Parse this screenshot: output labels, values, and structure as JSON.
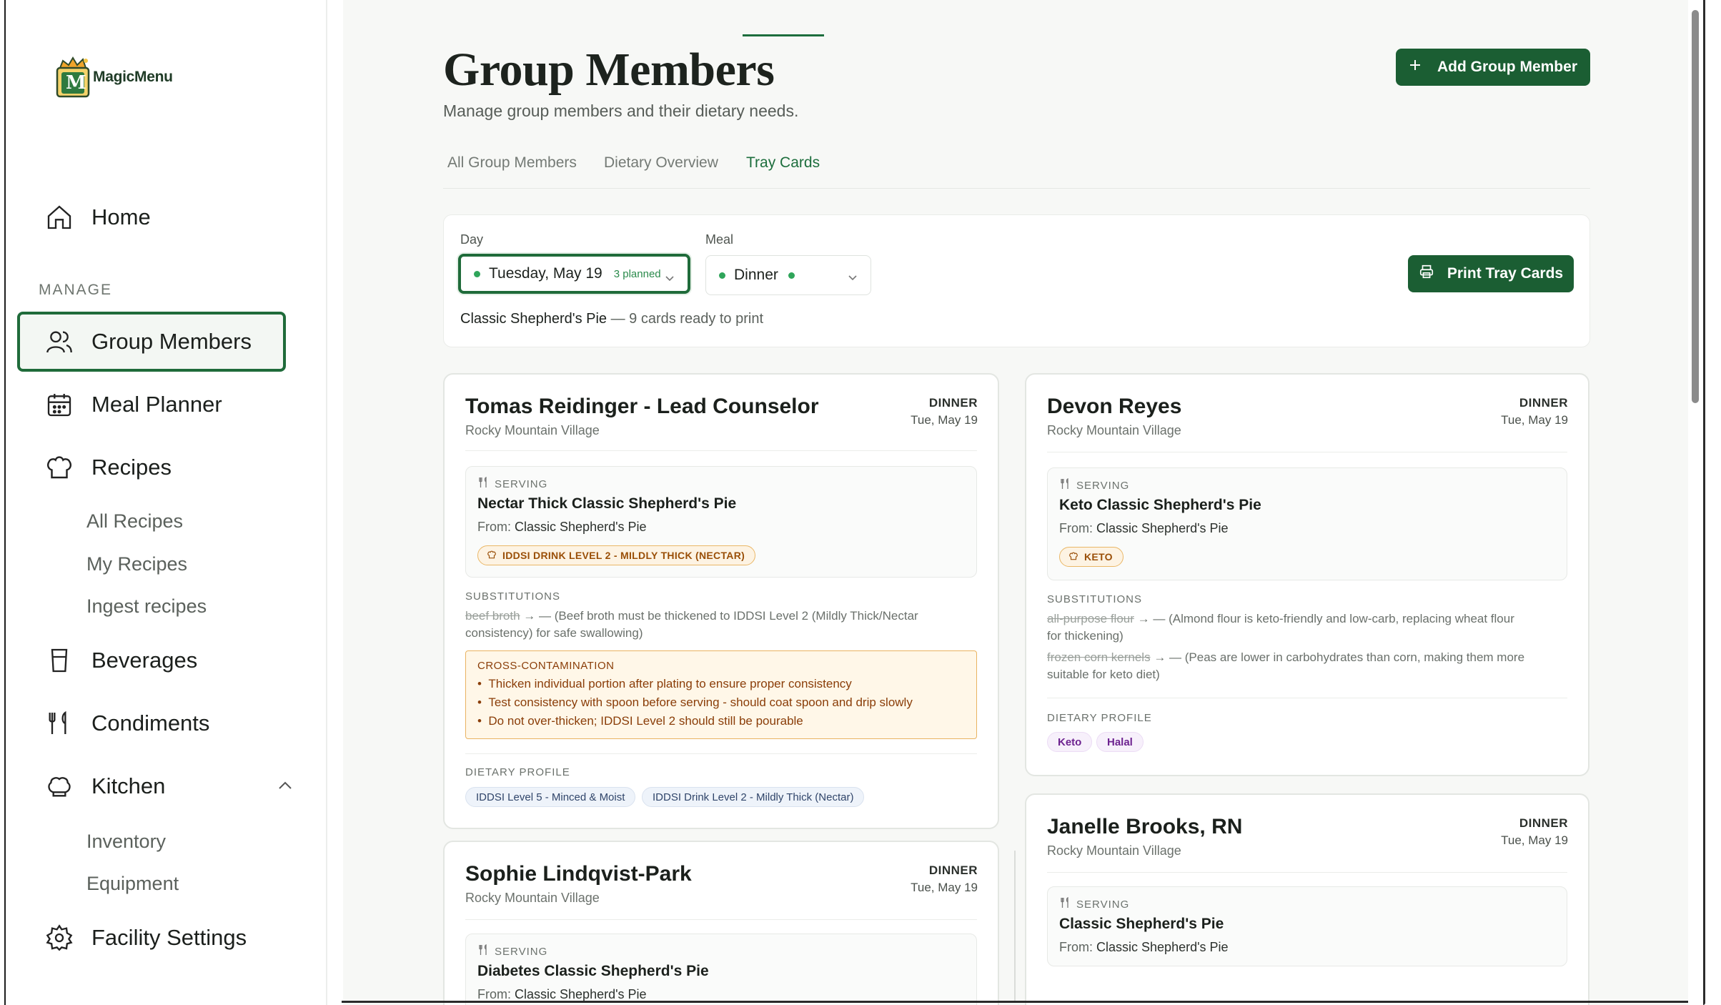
{
  "brand": {
    "name": "MagicMenu",
    "logo_letter": "M"
  },
  "sidebar": {
    "home": "Home",
    "section": "MANAGE",
    "group_members": "Group Members",
    "meal_planner": "Meal Planner",
    "recipes": "Recipes",
    "recipes_sub": [
      "All Recipes",
      "My Recipes",
      "Ingest recipes"
    ],
    "beverages": "Beverages",
    "condiments": "Condiments",
    "kitchen": "Kitchen",
    "kitchen_sub": [
      "Inventory",
      "Equipment"
    ],
    "facility_settings": "Facility Settings"
  },
  "header": {
    "title": "Group Members",
    "subtitle": "Manage group members and their dietary needs.",
    "add_button": "Add Group Member"
  },
  "tabs": [
    "All Group Members",
    "Dietary Overview",
    "Tray Cards"
  ],
  "active_tab": "Tray Cards",
  "filters": {
    "day_label": "Day",
    "day_value": "Tuesday, May 19",
    "day_badge": "3 planned",
    "meal_label": "Meal",
    "meal_value": "Dinner",
    "print_button": "Print Tray Cards",
    "summary_recipe": "Classic Shepherd's Pie",
    "summary_rest": "— 9 cards ready to print"
  },
  "labels": {
    "serving": "SERVING",
    "from": "From:",
    "substitutions": "SUBSTITUTIONS",
    "dietary_profile": "DIETARY PROFILE",
    "cross_contamination": "CROSS-CONTAMINATION"
  },
  "cards": [
    {
      "name": "Tomas Reidinger - Lead Counselor",
      "location": "Rocky Mountain Village",
      "meal": "DINNER",
      "date": "Tue, May 19",
      "serving_title": "Nectar Thick Classic Shepherd's Pie",
      "from": "Classic Shepherd's Pie",
      "tag": "IDDSI DRINK LEVEL 2 - MILDLY THICK (NECTAR)",
      "substitutions": [
        {
          "struck": "beef broth",
          "text": "→ — (Beef broth must be thickened to IDDSI Level 2 (Mildly Thick/Nectar consistency) for safe swallowing)"
        }
      ],
      "cross_items": [
        "Thicken individual portion after plating to ensure proper consistency",
        "Test consistency with spoon before serving - should coat spoon and drip slowly",
        "Do not over-thicken; IDDSI Level 2 should still be pourable"
      ],
      "profile": [
        "IDDSI Level 5 - Minced & Moist",
        "IDDSI Drink Level 2 - Mildly Thick (Nectar)"
      ]
    },
    {
      "name": "Devon Reyes",
      "location": "Rocky Mountain Village",
      "meal": "DINNER",
      "date": "Tue, May 19",
      "serving_title": "Keto Classic Shepherd's Pie",
      "from": "Classic Shepherd's Pie",
      "tag": "KETO",
      "substitutions": [
        {
          "struck": "all-purpose flour",
          "text": "→ — (Almond flour is keto-friendly and low-carb, replacing wheat flour",
          "text2": "for thickening)"
        },
        {
          "struck": "frozen corn kernels",
          "text": "→ — (Peas are lower in carbohydrates than corn, making them more",
          "text2": "suitable for keto diet)"
        }
      ],
      "profile": [
        "Keto",
        "Halal"
      ]
    },
    {
      "name": "Sophie Lindqvist-Park",
      "location": "Rocky Mountain Village",
      "meal": "DINNER",
      "date": "Tue, May 19",
      "serving_title": "Diabetes Classic Shepherd's Pie",
      "from": "Classic Shepherd's Pie"
    },
    {
      "name": "Janelle Brooks, RN",
      "location": "Rocky Mountain Village",
      "meal": "DINNER",
      "date": "Tue, May 19",
      "serving_title": "Classic Shepherd's Pie",
      "from": "Classic Shepherd's Pie"
    }
  ],
  "colors": {
    "brand_green": "#1b5e33",
    "accent_green": "#1d6e3d",
    "warning_bg": "#fff7e8",
    "warning_text": "#8a3d08"
  }
}
